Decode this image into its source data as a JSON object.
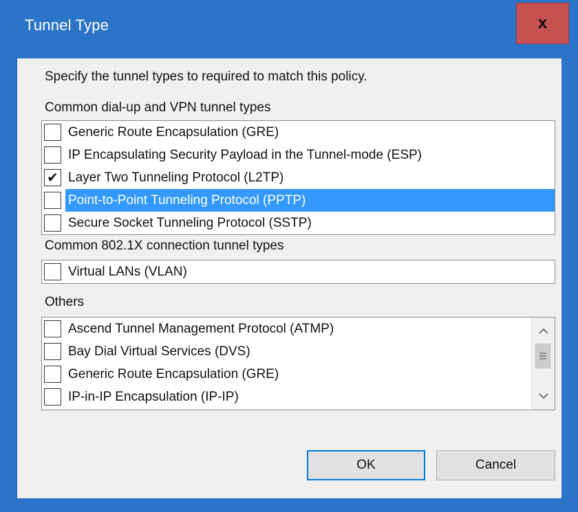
{
  "window": {
    "title": "Tunnel Type",
    "close_glyph": "x"
  },
  "dialog": {
    "instruction": "Specify the tunnel types to required to match this policy.",
    "groups": [
      {
        "label": "Common dial-up and VPN tunnel types",
        "items": [
          {
            "label": "Generic Route Encapsulation (GRE)",
            "checked": false,
            "selected": false
          },
          {
            "label": "IP Encapsulating Security Payload in the Tunnel-mode (ESP)",
            "checked": false,
            "selected": false
          },
          {
            "label": "Layer Two Tunneling Protocol (L2TP)",
            "checked": true,
            "selected": false
          },
          {
            "label": "Point-to-Point Tunneling Protocol (PPTP)",
            "checked": false,
            "selected": true
          },
          {
            "label": "Secure Socket Tunneling Protocol (SSTP)",
            "checked": false,
            "selected": false
          }
        ]
      },
      {
        "label": "Common 802.1X connection tunnel types",
        "items": [
          {
            "label": "Virtual LANs (VLAN)",
            "checked": false,
            "selected": false
          }
        ]
      },
      {
        "label": "Others",
        "items": [
          {
            "label": "Ascend Tunnel Management Protocol (ATMP)",
            "checked": false,
            "selected": false
          },
          {
            "label": "Bay Dial Virtual Services (DVS)",
            "checked": false,
            "selected": false
          },
          {
            "label": "Generic Route Encapsulation (GRE)",
            "checked": false,
            "selected": false
          },
          {
            "label": "IP-in-IP Encapsulation (IP-IP)",
            "checked": false,
            "selected": false
          }
        ]
      }
    ],
    "check_glyph": "✔",
    "scrollbar": {
      "up_icon": "chevron-up-icon",
      "down_icon": "chevron-down-icon",
      "thumb_icon": "grip-icon"
    },
    "buttons": {
      "ok": "OK",
      "cancel": "Cancel"
    }
  },
  "colors": {
    "title_bar": "#2b74c7",
    "close_button": "#c75050",
    "selection": "#3399ff",
    "dialog_bg": "#f0f0f0"
  }
}
